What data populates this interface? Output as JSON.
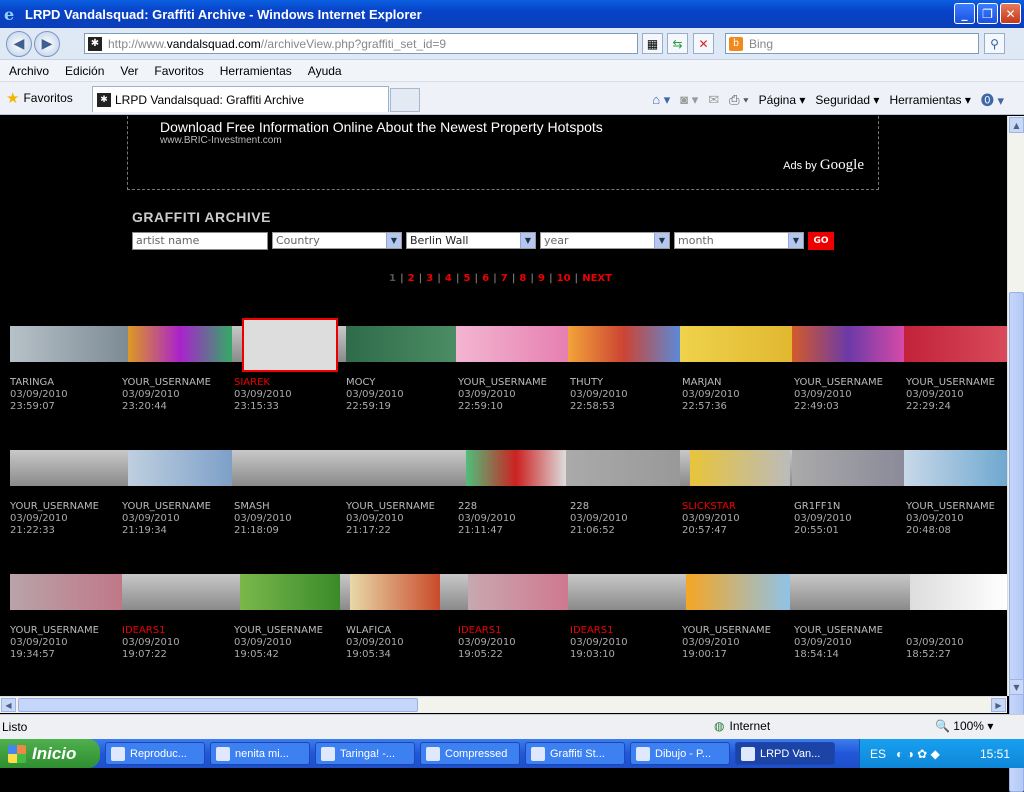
{
  "window": {
    "title": "LRPD Vandalsquad: Graffiti Archive - Windows Internet Explorer"
  },
  "address": {
    "prefix": "http://www.",
    "host": "vandalsquad.com",
    "path": "//archiveView.php?graffiti_set_id=9"
  },
  "search": {
    "placeholder": "Bing"
  },
  "menu": [
    "Archivo",
    "Edición",
    "Ver",
    "Favoritos",
    "Herramientas",
    "Ayuda"
  ],
  "favorites": {
    "label": "Favoritos",
    "tab": "LRPD Vandalsquad: Graffiti Archive"
  },
  "commands": [
    "Página ▾",
    "Seguridad ▾",
    "Herramientas ▾"
  ],
  "ad": {
    "title": "Download Free Information Online About the Newest Property Hotspots",
    "url": "www.BRIC-Investment.com",
    "ads_by": "Ads by",
    "google": "Google"
  },
  "archive": {
    "title": "GRAFFITI ARCHIVE",
    "artist_placeholder": "artist name",
    "country": "Country",
    "city": "Berlin Wall",
    "year": "year",
    "month": "month",
    "go": "GO"
  },
  "pager": {
    "current": "1",
    "pages": [
      "2",
      "3",
      "4",
      "5",
      "6",
      "7",
      "8",
      "9",
      "10"
    ],
    "next": "NEXT"
  },
  "rows": [
    [
      {
        "name": "TARINGA",
        "date": "03/09/2010",
        "time": "23:59:07",
        "red": false
      },
      {
        "name": "YOUR_USERNAME",
        "date": "03/09/2010",
        "time": "23:20:44",
        "red": false
      },
      {
        "name": "SIAREK",
        "date": "03/09/2010",
        "time": "23:15:33",
        "red": true
      },
      {
        "name": "MOCY",
        "date": "03/09/2010",
        "time": "22:59:19",
        "red": false
      },
      {
        "name": "YOUR_USERNAME",
        "date": "03/09/2010",
        "time": "22:59:10",
        "red": false
      },
      {
        "name": "THUTY",
        "date": "03/09/2010",
        "time": "22:58:53",
        "red": false
      },
      {
        "name": "MARJAN",
        "date": "03/09/2010",
        "time": "22:57:36",
        "red": false
      },
      {
        "name": "YOUR_USERNAME",
        "date": "03/09/2010",
        "time": "22:49:03",
        "red": false
      },
      {
        "name": "YOUR_USERNAME",
        "date": "03/09/2010",
        "time": "22:29:24",
        "red": false
      }
    ],
    [
      {
        "name": "YOUR_USERNAME",
        "date": "03/09/2010",
        "time": "21:22:33",
        "red": false
      },
      {
        "name": "YOUR_USERNAME",
        "date": "03/09/2010",
        "time": "21:19:34",
        "red": false
      },
      {
        "name": "SMASH",
        "date": "03/09/2010",
        "time": "21:18:09",
        "red": false
      },
      {
        "name": "YOUR_USERNAME",
        "date": "03/09/2010",
        "time": "21:17:22",
        "red": false
      },
      {
        "name": "228",
        "date": "03/09/2010",
        "time": "21:11:47",
        "red": false
      },
      {
        "name": "228",
        "date": "03/09/2010",
        "time": "21:06:52",
        "red": false
      },
      {
        "name": "SLICKSTAR",
        "date": "03/09/2010",
        "time": "20:57:47",
        "red": true
      },
      {
        "name": "GR1FF1N",
        "date": "03/09/2010",
        "time": "20:55:01",
        "red": false
      },
      {
        "name": "YOUR_USERNAME",
        "date": "03/09/2010",
        "time": "20:48:08",
        "red": false
      }
    ],
    [
      {
        "name": "YOUR_USERNAME",
        "date": "03/09/2010",
        "time": "19:34:57",
        "red": false
      },
      {
        "name": "IDEARS1",
        "date": "03/09/2010",
        "time": "19:07:22",
        "red": true
      },
      {
        "name": "YOUR_USERNAME",
        "date": "03/09/2010",
        "time": "19:05:42",
        "red": false
      },
      {
        "name": "WLAFICA",
        "date": "03/09/2010",
        "time": "19:05:34",
        "red": false
      },
      {
        "name": "IDEARS1",
        "date": "03/09/2010",
        "time": "19:05:22",
        "red": true
      },
      {
        "name": "IDEARS1",
        "date": "03/09/2010",
        "time": "19:03:10",
        "red": true
      },
      {
        "name": "YOUR_USERNAME",
        "date": "03/09/2010",
        "time": "19:00:17",
        "red": false
      },
      {
        "name": "YOUR_USERNAME",
        "date": "03/09/2010",
        "time": "18:54:14",
        "red": false
      },
      {
        "name": "",
        "date": "03/09/2010",
        "time": "18:52:27",
        "red": false
      }
    ]
  ],
  "status": {
    "text": "Listo",
    "zone": "Internet",
    "zoom": "100%"
  },
  "taskbar": {
    "start": "Inicio",
    "tasks": [
      "Reproduc...",
      "nenita mi...",
      "Taringa! -...",
      "Compressed",
      "Graffiti St...",
      "Dibujo - P...",
      "LRPD Van..."
    ],
    "lang": "ES",
    "clock": "15:51"
  }
}
